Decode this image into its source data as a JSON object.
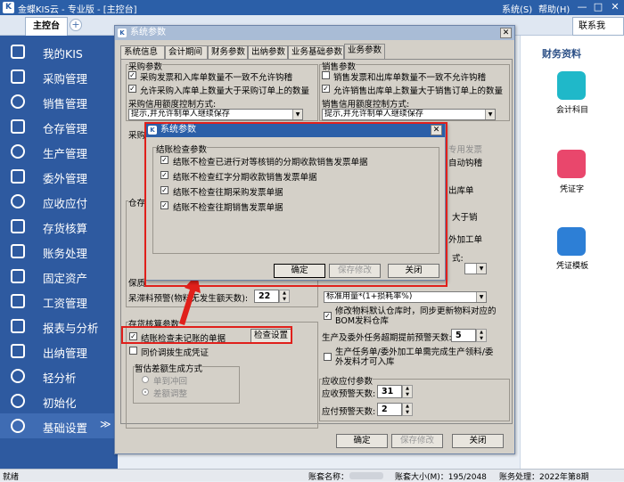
{
  "app": {
    "title": "金蝶KIS云 - 专业版 - [主控台]",
    "menus": [
      "系统(S)",
      "帮助(H)"
    ],
    "window_controls": [
      "—",
      "□",
      "✕"
    ]
  },
  "tabs": {
    "home": "主控台",
    "add": "+",
    "contact": "联系我"
  },
  "sidebar": {
    "items": [
      {
        "label": "我的KIS",
        "icon": "monitor-icon"
      },
      {
        "label": "采购管理",
        "icon": "cart-icon"
      },
      {
        "label": "销售管理",
        "icon": "person-icon"
      },
      {
        "label": "仓存管理",
        "icon": "warehouse-icon"
      },
      {
        "label": "生产管理",
        "icon": "gear-icon"
      },
      {
        "label": "委外管理",
        "icon": "outsource-icon"
      },
      {
        "label": "应收应付",
        "icon": "money-icon"
      },
      {
        "label": "存货核算",
        "icon": "calculator-icon"
      },
      {
        "label": "账务处理",
        "icon": "book-icon"
      },
      {
        "label": "固定资产",
        "icon": "asset-icon"
      },
      {
        "label": "工资管理",
        "icon": "salary-icon"
      },
      {
        "label": "报表与分析",
        "icon": "chart-icon"
      },
      {
        "label": "出纳管理",
        "icon": "cashier-icon"
      },
      {
        "label": "轻分析",
        "icon": "analysis-icon"
      },
      {
        "label": "初始化",
        "icon": "init-icon"
      },
      {
        "label": "基础设置",
        "icon": "settings-icon"
      }
    ],
    "collapse": "≫"
  },
  "right_panel": {
    "title": "财务资料",
    "tiles": [
      {
        "label": "会计科目",
        "color": "#1fb8c9",
        "icon": "ledger-icon"
      },
      {
        "label": "凭证字",
        "color": "#e9476c",
        "icon": "voucher-word-icon"
      },
      {
        "label": "凭证模板",
        "color": "#2d7fd6",
        "icon": "voucher-template-icon"
      }
    ]
  },
  "status": {
    "left": "就绪",
    "account_name_label": "账套名称：",
    "data_size": "账套大小(M)：195/2048",
    "period": "账务处理：2022年第8期"
  },
  "dialog": {
    "title": "系统参数",
    "tabs": [
      "系统信息",
      "会计期间",
      "财务参数",
      "出纳参数",
      "业务基础参数",
      "业务参数"
    ],
    "selected_tab": "业务参数",
    "purchase": {
      "title": "采购参数",
      "options": [
        {
          "label": "采购发票和入库单数量不一致不允许钩稽",
          "checked": true
        },
        {
          "label": "允许采购入库单上数量大于采购订单上的数量",
          "checked": true
        }
      ],
      "credit_label": "采购信用额度控制方式:",
      "credit_value": "提示,并允许制单人继续保存",
      "truncated_label": "采购"
    },
    "sales": {
      "title": "销售参数",
      "options": [
        {
          "label": "销售发票和出库单数量不一致不允许钩稽",
          "checked": false
        },
        {
          "label": "允许销售出库单上数量大于销售订单上的数量",
          "checked": true
        }
      ],
      "credit_label": "销售信用额度控制方式:",
      "credit_value": "提示,并允许制单人继续保存",
      "partial": [
        "专用发票",
        "自动钩稽",
        "出库单",
        "大于销",
        "外加工单",
        "式:"
      ]
    },
    "storage": {
      "title": "仓存",
      "keep_label": "保质",
      "slow_label": "呆滞料预警(物料无发生额天数):",
      "slow_value": "22"
    },
    "calc": {
      "title": "存货核算参数",
      "checkout_check": {
        "label": "结账检查未记账的单据",
        "checked": true
      },
      "check_settings_btn": "检查设置",
      "sync_voucher": {
        "label": "同价调拨生成凭证",
        "checked": false
      },
      "diff_title": "暂估差额生成方式",
      "radios": [
        {
          "label": "单到冲回",
          "checked": false
        },
        {
          "label": "差额调整",
          "checked": true
        }
      ]
    },
    "production": {
      "material_value": "标准用量*(1+损耗率%)",
      "options": [
        {
          "label": "修改物料默认仓库时，同步更新物料对应的BOM发料仓库",
          "checked": true
        }
      ],
      "overdue_label": "生产及委外任务超期提前预警天数:",
      "overdue_value": "5",
      "must_finish": {
        "label": "生产任务单/委外加工单需完成生产领料/委外发料才可入库",
        "checked": false
      }
    },
    "arap": {
      "title": "应收应付参数",
      "receivable_label": "应收预警天数:",
      "receivable_value": "31",
      "payable_label": "应付预警天数:",
      "payable_value": "2"
    },
    "buttons": {
      "ok": "确定",
      "save": "保存修改",
      "close": "关闭"
    }
  },
  "subdialog": {
    "title": "系统参数",
    "group_title": "结账检查参数",
    "options": [
      {
        "label": "结账不检查已进行对等核销的分期收款销售发票单据",
        "checked": true
      },
      {
        "label": "结账不检查红字分期收款销售发票单据",
        "checked": true
      },
      {
        "label": "结账不检查往期采购发票单据",
        "checked": true
      },
      {
        "label": "结账不检查往期销售发票单据",
        "checked": true
      }
    ],
    "buttons": {
      "ok": "确定",
      "save": "保存修改",
      "close": "关闭"
    }
  }
}
